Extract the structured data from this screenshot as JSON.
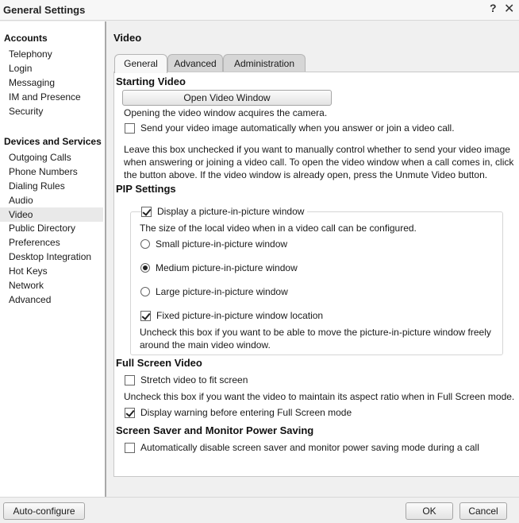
{
  "window": {
    "title": "General Settings",
    "help_glyph": "?",
    "close_glyph": "✕"
  },
  "sidebar": {
    "sections": [
      {
        "header": "Accounts",
        "items": [
          "Telephony",
          "Login",
          "Messaging",
          "IM and Presence",
          "Security"
        ]
      },
      {
        "header": "Devices and Services",
        "items": [
          "Outgoing Calls",
          "Phone Numbers",
          "Dialing Rules",
          "Audio",
          "Video",
          "Public Directory",
          "Preferences",
          "Desktop Integration",
          "Hot Keys",
          "Network",
          "Advanced"
        ]
      }
    ],
    "selected": "Video"
  },
  "main": {
    "title": "Video",
    "tabs": [
      "General",
      "Advanced",
      "Administration"
    ],
    "active_tab": "General",
    "starting_video": {
      "title": "Starting Video",
      "open_button": "Open Video Window",
      "note": "Opening the video window acquires the camera.",
      "send_auto_label": "Send your video image automatically when you answer or join a video call.",
      "send_auto_checked": false,
      "help_line1": "Leave this box unchecked if you want to manually control whether to send your video image",
      "help_line2": "when answering or joining a video call. To open the video window when a call comes in, click",
      "help_line3": "the button above. If the video window is already open, press the Unmute Video button."
    },
    "pip": {
      "title": "PIP Settings",
      "display_label": "Display a picture-in-picture window",
      "display_checked": true,
      "size_note": "The size of the local video when in a video call can be configured.",
      "small_label": "Small picture-in-picture window",
      "medium_label": "Medium picture-in-picture window",
      "large_label": "Large picture-in-picture window",
      "selected_size": "Medium picture-in-picture window",
      "fixed_label": "Fixed picture-in-picture window location",
      "fixed_checked": true,
      "fixed_help_line1": "Uncheck this box if you want to be able to move the picture-in-picture window freely",
      "fixed_help_line2": "around the main video window."
    },
    "fullscreen": {
      "title": "Full Screen Video",
      "stretch_label": "Stretch video to fit screen",
      "stretch_checked": false,
      "stretch_help": "Uncheck this box if you want the video to maintain its aspect ratio when in Full Screen mode.",
      "warning_label": "Display warning before entering Full Screen mode",
      "warning_checked": true
    },
    "screensaver": {
      "title": "Screen Saver and Monitor Power Saving",
      "disable_label": "Automatically disable screen saver and monitor power saving mode during a call",
      "disable_checked": false
    }
  },
  "footer": {
    "auto_configure": "Auto-configure",
    "ok": "OK",
    "cancel": "Cancel"
  }
}
